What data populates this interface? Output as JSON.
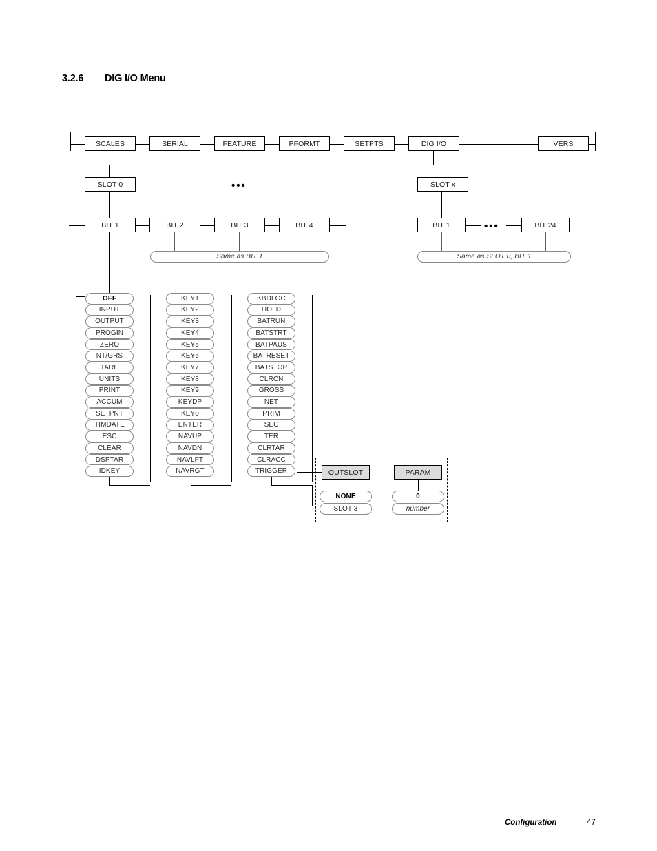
{
  "section": {
    "number": "3.2.6",
    "title": "DIG I/O Menu"
  },
  "footer": {
    "label": "Configuration",
    "page": "47"
  },
  "diagram": {
    "top_menu": [
      "SCALES",
      "SERIAL",
      "FEATURE",
      "PFORMT",
      "SETPTS",
      "DIG I/O",
      "VERS"
    ],
    "slot_row": {
      "first": "SLOT 0",
      "last": "SLOT x",
      "ellipsis": "•••"
    },
    "bit_row_left": [
      "BIT 1",
      "BIT 2",
      "BIT 3",
      "BIT 4"
    ],
    "bit_row_right": {
      "first": "BIT 1",
      "last": "BIT 24",
      "ellipsis": "•••"
    },
    "same_as_bit1": "Same as BIT 1",
    "same_as_slot0_bit1": "Same as SLOT 0, BIT 1",
    "column1": [
      "OFF",
      "INPUT",
      "OUTPUT",
      "PROGIN",
      "ZERO",
      "NT/GRS",
      "TARE",
      "UNITS",
      "PRINT",
      "ACCUM",
      "SETPNT",
      "TIMDATE",
      "ESC",
      "CLEAR",
      "DSPTAR",
      "IDKEY"
    ],
    "column2": [
      "KEY1",
      "KEY2",
      "KEY3",
      "KEY4",
      "KEY5",
      "KEY6",
      "KEY7",
      "KEY8",
      "KEY9",
      "KEYDP",
      "KEY0",
      "ENTER",
      "NAVUP",
      "NAVDN",
      "NAVLFT",
      "NAVRGT"
    ],
    "column3": [
      "KBDLOC",
      "HOLD",
      "BATRUN",
      "BATSTRT",
      "BATPAUS",
      "BATRESET",
      "BATSTOP",
      "CLRCN",
      "GROSS",
      "NET",
      "PRIM",
      "SEC",
      "TER",
      "CLRTAR",
      "CLRACC",
      "TRIGGER"
    ],
    "trigger_group": {
      "outslot": {
        "header": "OUTSLOT",
        "options": [
          "NONE",
          "SLOT 3"
        ]
      },
      "param": {
        "header": "PARAM",
        "options": [
          "0",
          "number"
        ]
      }
    }
  }
}
